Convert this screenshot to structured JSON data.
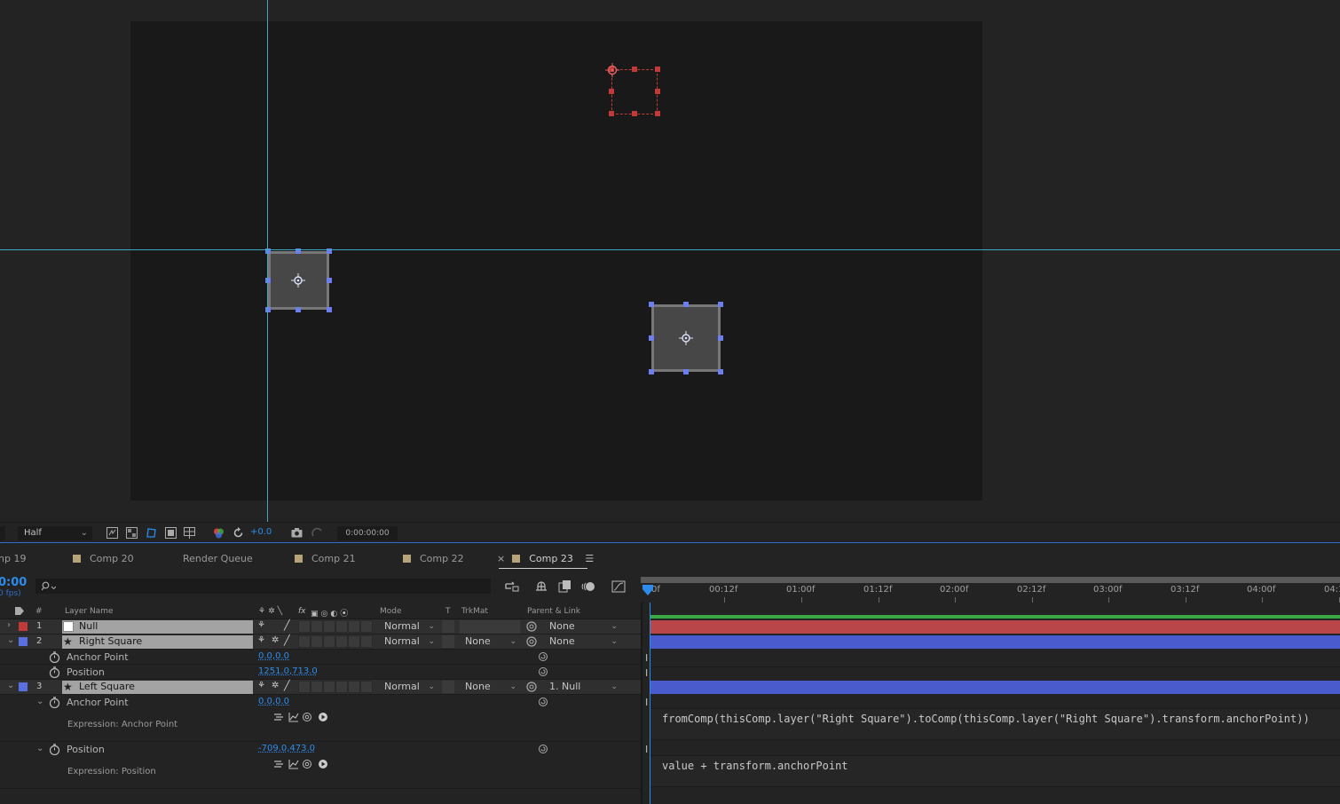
{
  "viewer": {
    "resolution": "Half",
    "exposure": "+0.0",
    "timecode": "0:00:00:00"
  },
  "tabs": [
    {
      "label": "np 19",
      "swatch": false
    },
    {
      "label": "Comp 20",
      "swatch": true
    },
    {
      "label": "Render Queue",
      "swatch": false
    },
    {
      "label": "Comp 21",
      "swatch": true
    },
    {
      "label": "Comp 22",
      "swatch": true
    },
    {
      "label": "Comp 23",
      "swatch": true,
      "active": true,
      "close": "×"
    }
  ],
  "timeline": {
    "current_time": "0:00",
    "fps": "0 fps)",
    "search_placeholder": "",
    "ruler_labels": [
      "0f",
      "00:12f",
      "01:00f",
      "01:12f",
      "02:00f",
      "02:12f",
      "03:00f",
      "03:12f",
      "04:00f",
      "04:1"
    ]
  },
  "columns": {
    "num": "#",
    "layer_name": "Layer Name",
    "mode": "Mode",
    "t": "T",
    "trkmat": "TrkMat",
    "parent": "Parent & Link"
  },
  "layers": [
    {
      "num": "1",
      "name": "Null",
      "label_color": "#c03a3a",
      "mode": "Normal",
      "trkmat": "",
      "parent": "None",
      "bar_color": "#b9474a"
    },
    {
      "num": "2",
      "name": "Right Square",
      "label_color": "#5a6fe0",
      "mode": "Normal",
      "trkmat": "None",
      "parent": "None",
      "bar_color": "#4a5ccd"
    },
    {
      "num": "3",
      "name": "Left Square",
      "label_color": "#5a6fe0",
      "mode": "Normal",
      "trkmat": "None",
      "parent": "1. Null",
      "bar_color": "#4a5ccd"
    }
  ],
  "properties": {
    "right_anchor": {
      "name": "Anchor Point",
      "value": "0.0,0.0"
    },
    "right_position": {
      "name": "Position",
      "value": "1251.0,713.0"
    },
    "left_anchor": {
      "name": "Anchor Point",
      "value": "0.0,0.0"
    },
    "left_anchor_expr_label": "Expression: Anchor Point",
    "left_anchor_expr": "fromComp(thisComp.layer(\"Right Square\").toComp(thisComp.layer(\"Right Square\").transform.anchorPoint))",
    "left_position": {
      "name": "Position",
      "value": "-709.0,473.0"
    },
    "left_position_expr_label": "Expression: Position",
    "left_position_expr": "value + transform.anchorPoint"
  },
  "colors": {
    "accent_blue": "#2d8ceb",
    "guide": "#3fa6c4",
    "null_red": "#c03a3a",
    "layer_blue": "#5a6fe0",
    "work_area_green": "#3aa845"
  }
}
